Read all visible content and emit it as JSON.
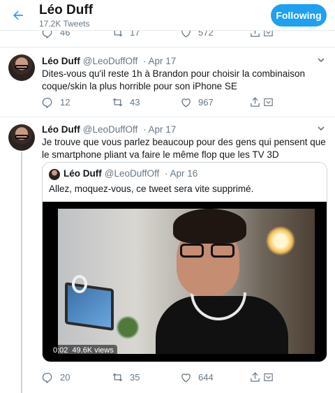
{
  "header": {
    "name": "Léo Duff",
    "tweet_count": "17.2K Tweets",
    "follow_label": "Following"
  },
  "colors": {
    "accent": "#1da1f2",
    "muted": "#657786",
    "border": "#e6ecf0"
  },
  "tweets": [
    {
      "name": "",
      "handle": "",
      "date": "",
      "text": "",
      "replies": "46",
      "retweets": "17",
      "likes": "572"
    },
    {
      "name": "Léo Duff",
      "handle": "@LeoDuffOff",
      "date": "· Apr 17",
      "text": "Dites-vous qu'il reste 1h à Brandon pour choisir la combinaison coque/skin la plus horrible pour son iPhone SE",
      "replies": "12",
      "retweets": "43",
      "likes": "967"
    },
    {
      "name": "Léo Duff",
      "handle": "@LeoDuffOff",
      "date": "· Apr 17",
      "text": "Je trouve que vous parlez beaucoup pour des gens qui pensent que le smartphone pliant va faire le même flop que les TV 3D",
      "quote": {
        "name": "Léo Duff",
        "handle": "@LeoDuffOff",
        "date": "· Apr 16",
        "text": "Allez, moquez-vous, ce tweet sera vite supprimé.",
        "video_time": "0:02",
        "video_views": "49.6K views"
      },
      "replies": "20",
      "retweets": "35",
      "likes": "644"
    }
  ],
  "icons": {
    "back": "arrow-left-icon",
    "reply": "reply-icon",
    "retweet": "retweet-icon",
    "like": "heart-icon",
    "share": "share-icon",
    "caret": "chevron-down-icon"
  }
}
